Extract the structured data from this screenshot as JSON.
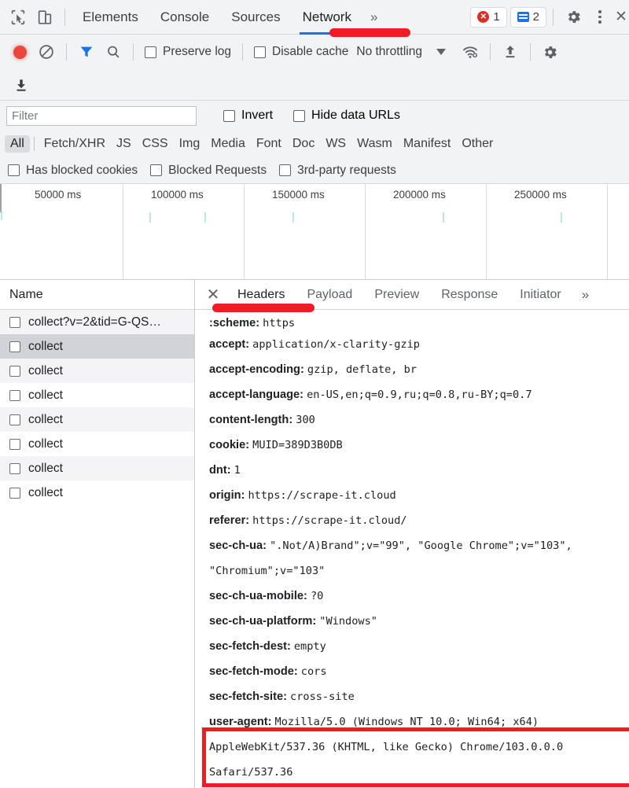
{
  "devtools": {
    "main_tabs": [
      {
        "label": "Elements",
        "active": false
      },
      {
        "label": "Console",
        "active": false
      },
      {
        "label": "Sources",
        "active": false
      },
      {
        "label": "Network",
        "active": true
      }
    ],
    "overflow_chevron": "»",
    "error_count": "1",
    "message_count": "2",
    "icons": {
      "inspect": "inspect-element-icon",
      "device": "device-toolbar-icon",
      "settings": "gear-icon",
      "more": "kebab-menu-icon",
      "close": "close-icon"
    }
  },
  "network_toolbar": {
    "record_label": "record-button",
    "clear_label": "clear-button",
    "filter_toggle_label": "filter-funnel-button",
    "search_label": "search-button",
    "preserve_log": {
      "label": "Preserve log",
      "checked": false
    },
    "disable_cache": {
      "label": "Disable cache",
      "checked": false
    },
    "throttling": "No throttling",
    "import_har_label": "import-har-button",
    "download_har_label": "export-har-button",
    "network_conditions_label": "network-conditions-icon",
    "settings_label": "network-settings-icon"
  },
  "filter_bar": {
    "placeholder": "Filter",
    "value": "",
    "invert": {
      "label": "Invert",
      "checked": false
    },
    "hide_data_urls": {
      "label": "Hide data URLs",
      "checked": false
    }
  },
  "type_chips": [
    {
      "label": "All",
      "selected": true
    },
    {
      "label": "Fetch/XHR",
      "selected": false
    },
    {
      "label": "JS",
      "selected": false
    },
    {
      "label": "CSS",
      "selected": false
    },
    {
      "label": "Img",
      "selected": false
    },
    {
      "label": "Media",
      "selected": false
    },
    {
      "label": "Font",
      "selected": false
    },
    {
      "label": "Doc",
      "selected": false
    },
    {
      "label": "WS",
      "selected": false
    },
    {
      "label": "Wasm",
      "selected": false
    },
    {
      "label": "Manifest",
      "selected": false
    },
    {
      "label": "Other",
      "selected": false
    }
  ],
  "blocked_row": [
    {
      "label": "Has blocked cookies",
      "checked": false
    },
    {
      "label": "Blocked Requests",
      "checked": false
    },
    {
      "label": "3rd-party requests",
      "checked": false
    }
  ],
  "overview": {
    "tick_labels": [
      "50000 ms",
      "100000 ms",
      "150000 ms",
      "200000 ms",
      "250000 ms"
    ],
    "tick_color": "#9fe2d4"
  },
  "request_list": {
    "column_header": "Name",
    "rows": [
      {
        "name": "collect?v=2&tid=G-QS…",
        "checked": false,
        "state": "alt"
      },
      {
        "name": "collect",
        "checked": false,
        "state": "active"
      },
      {
        "name": "collect",
        "checked": false,
        "state": "alt"
      },
      {
        "name": "collect",
        "checked": false,
        "state": "plain"
      },
      {
        "name": "collect",
        "checked": false,
        "state": "alt"
      },
      {
        "name": "collect",
        "checked": false,
        "state": "plain"
      },
      {
        "name": "collect",
        "checked": false,
        "state": "alt"
      },
      {
        "name": "collect",
        "checked": false,
        "state": "plain"
      }
    ]
  },
  "detail_panel": {
    "tabs": [
      {
        "label": "Headers",
        "active": true
      },
      {
        "label": "Payload",
        "active": false
      },
      {
        "label": "Preview",
        "active": false
      },
      {
        "label": "Response",
        "active": false
      },
      {
        "label": "Initiator",
        "active": false
      }
    ],
    "more": "»",
    "headers": [
      {
        "key": ":scheme:",
        "value": "https",
        "clipped": true
      },
      {
        "key": "accept:",
        "value": "application/x-clarity-gzip"
      },
      {
        "key": "accept-encoding:",
        "value": "gzip, deflate, br"
      },
      {
        "key": "accept-language:",
        "value": "en-US,en;q=0.9,ru;q=0.8,ru-BY;q=0.7"
      },
      {
        "key": "content-length:",
        "value": "300"
      },
      {
        "key": "cookie:",
        "value": "MUID=389D3B0DB"
      },
      {
        "key": "dnt:",
        "value": "1"
      },
      {
        "key": "origin:",
        "value": "https://scrape-it.cloud"
      },
      {
        "key": "referer:",
        "value": "https://scrape-it.cloud/"
      },
      {
        "key": "sec-ch-ua:",
        "value": "\".Not/A)Brand\";v=\"99\", \"Google Chrome\";v=\"103\", \"Chromium\";v=\"103\""
      },
      {
        "key": "sec-ch-ua-mobile:",
        "value": "?0"
      },
      {
        "key": "sec-ch-ua-platform:",
        "value": "\"Windows\""
      },
      {
        "key": "sec-fetch-dest:",
        "value": "empty"
      },
      {
        "key": "sec-fetch-mode:",
        "value": "cors"
      },
      {
        "key": "sec-fetch-site:",
        "value": "cross-site"
      },
      {
        "key": "user-agent:",
        "value": "Mozilla/5.0 (Windows NT 10.0; Win64; x64) AppleWebKit/537.36 (KHTML, like Gecko) Chrome/103.0.0.0 Safari/537.36",
        "highlighted": true
      }
    ]
  },
  "annotations": {
    "underline_color": "#ee1c25",
    "active_tab_color": "#1a73e8",
    "highlight_box_color": "#ee1c25"
  }
}
